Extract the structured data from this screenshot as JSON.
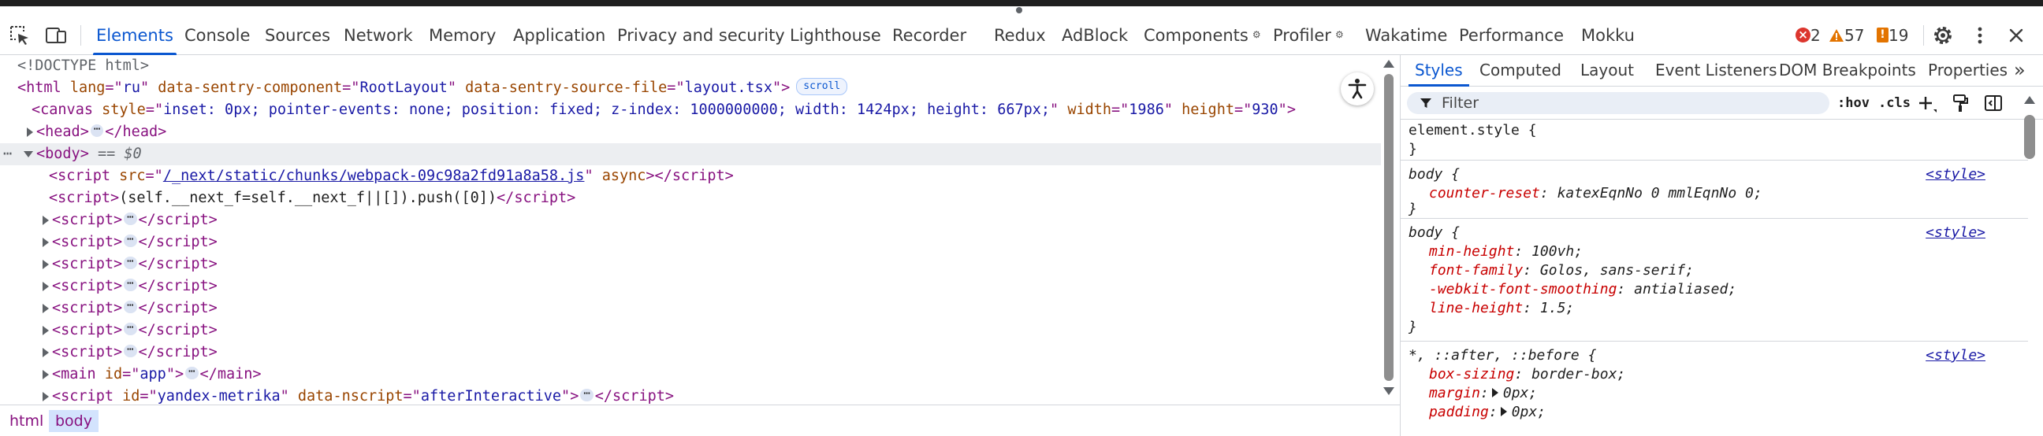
{
  "toolbar": {
    "tabs": [
      {
        "label": "Elements"
      },
      {
        "label": "Console"
      },
      {
        "label": "Sources"
      },
      {
        "label": "Network"
      },
      {
        "label": "Memory"
      },
      {
        "label": "Application"
      },
      {
        "label": "Privacy and security"
      },
      {
        "label": "Lighthouse"
      },
      {
        "label": "Recorder"
      },
      {
        "label": "Redux"
      },
      {
        "label": "AdBlock"
      },
      {
        "label": "Components"
      },
      {
        "label": "Profiler"
      },
      {
        "label": "Wakatime"
      },
      {
        "label": "Performance"
      },
      {
        "label": "Mokku"
      }
    ],
    "active_tab": "Elements",
    "errors": "2",
    "warnings": "57",
    "issues": "19",
    "icons": [
      "inspect-element-icon",
      "device-toggle-icon",
      "gear-icon",
      "kebab-menu-icon",
      "close-icon"
    ]
  },
  "elements": {
    "doctype": "<!DOCTYPE html>",
    "html_tag": "html",
    "html_attrs": [
      {
        "name": "lang",
        "value": "ru"
      },
      {
        "name": "data-sentry-component",
        "value": "RootLayout"
      },
      {
        "name": "data-sentry-source-file",
        "value": "layout.tsx"
      }
    ],
    "scroll_badge": "scroll",
    "canvas_style": "inset: 0px; pointer-events: none; position: fixed; z-index: 1000000000; width: 1424px; height: 667px;",
    "canvas_width": "1986",
    "canvas_height": "930",
    "body_marker": "== $0",
    "script_src": "/_next/static/chunks/webpack-09c98a2fd91a8a58.js",
    "script_inline": "(self.__next_f=self.__next_f||[]).push([0])",
    "main_id": "app",
    "last_script_id": "yandex-metrika",
    "last_script_attr_value": "afterInteractive",
    "ellipsis": "⋯",
    "row_dots": "⋯"
  },
  "breadcrumb": [
    "html",
    "body"
  ],
  "styles": {
    "tabs": [
      "Styles",
      "Computed",
      "Layout",
      "Event Listeners",
      "DOM Breakpoints",
      "Properties"
    ],
    "more": "»",
    "filter_placeholder": "Filter",
    "hov": ":hov",
    "cls": ".cls",
    "rules": [
      {
        "selector": "element.style {",
        "source": "",
        "props": []
      },
      {
        "selector": "body {",
        "source": "<style>",
        "props": [
          {
            "name": "counter-reset",
            "value": "katexEqnNo 0 mmlEqnNo 0;"
          }
        ]
      },
      {
        "selector": "body {",
        "source": "<style>",
        "props": [
          {
            "name": "min-height",
            "value": "100vh;"
          },
          {
            "name": "font-family",
            "value": "Golos, sans-serif;"
          },
          {
            "name": "-webkit-font-smoothing",
            "value": "antialiased;"
          },
          {
            "name": "line-height",
            "value": "1.5;"
          }
        ]
      },
      {
        "selector": "*, ::after, ::before {",
        "source": "<style>",
        "props": [
          {
            "name": "box-sizing",
            "value": "border-box;"
          },
          {
            "name": "margin",
            "value": "0px;"
          },
          {
            "name": "padding",
            "value": "0px;"
          }
        ]
      }
    ]
  }
}
